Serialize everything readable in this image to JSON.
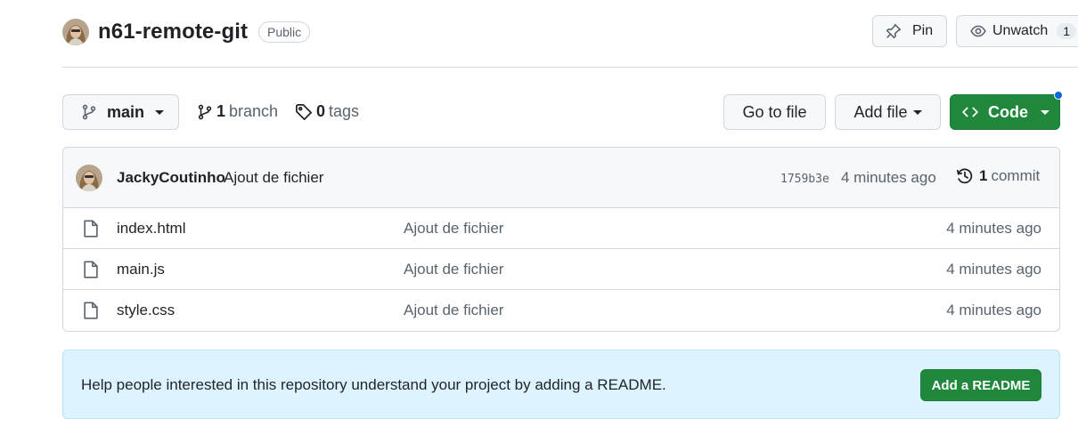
{
  "repo": {
    "name": "n61-remote-git",
    "visibility": "Public"
  },
  "actions": {
    "pin_label": "Pin",
    "unwatch_label": "Unwatch",
    "watch_count": "1"
  },
  "toolbar": {
    "branch_name": "main",
    "branch_count": "1",
    "branch_label": "branch",
    "tag_count": "0",
    "tag_label": "tags",
    "goto_file_label": "Go to file",
    "add_file_label": "Add file",
    "code_label": "Code"
  },
  "latest_commit": {
    "author": "JackyCoutinho",
    "message": "Ajout de fichier",
    "sha": "1759b3e",
    "time": "4 minutes ago",
    "commit_count": "1",
    "commit_label": "commit"
  },
  "files": [
    {
      "name": "index.html",
      "message": "Ajout de fichier",
      "time": "4 minutes ago",
      "icon": "file-icon"
    },
    {
      "name": "main.js",
      "message": "Ajout de fichier",
      "time": "4 minutes ago",
      "icon": "file-icon"
    },
    {
      "name": "style.css",
      "message": "Ajout de fichier",
      "time": "4 minutes ago",
      "icon": "file-icon"
    }
  ],
  "readme": {
    "text": "Help people interested in this repository understand your project by adding a README.",
    "button_label": "Add a README"
  },
  "colors": {
    "primary_green": "#1f883d",
    "banner_bg": "#ddf4ff",
    "notification_blue": "#0969da"
  }
}
